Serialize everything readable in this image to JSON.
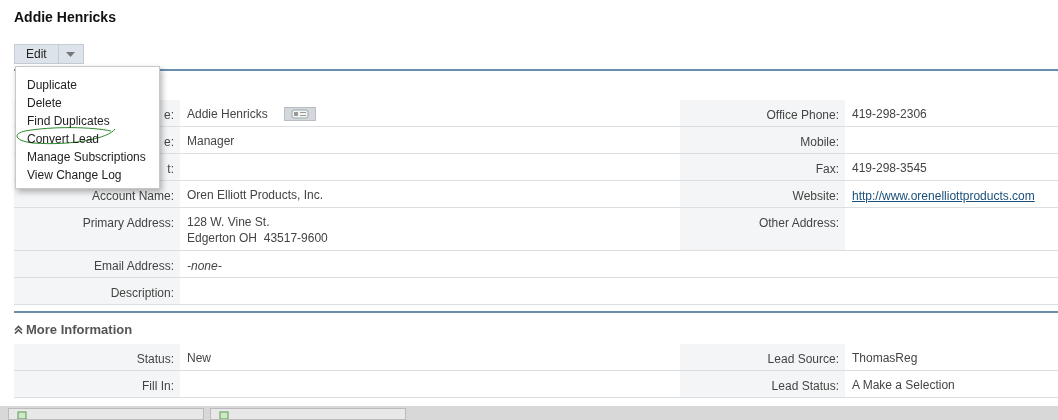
{
  "title": "Addie Henricks",
  "edit_button": {
    "label": "Edit"
  },
  "menu": {
    "items": [
      {
        "label": "Duplicate",
        "circled": false
      },
      {
        "label": "Delete",
        "circled": false
      },
      {
        "label": "Find Duplicates",
        "circled": false
      },
      {
        "label": "Convert Lead",
        "circled": true
      },
      {
        "label": "Manage Subscriptions",
        "circled": false
      },
      {
        "label": "View Change Log",
        "circled": false
      }
    ]
  },
  "overview": {
    "rows": [
      {
        "left": {
          "label": "e:",
          "kind": "card",
          "lines": [
            "Addie Henricks"
          ]
        },
        "right": {
          "label": "Office Phone:",
          "kind": "text",
          "lines": [
            "419-298-2306"
          ]
        }
      },
      {
        "left": {
          "label": "e:",
          "kind": "text",
          "lines": [
            "Manager"
          ]
        },
        "right": {
          "label": "Mobile:"
        }
      },
      {
        "left": {
          "label": "t:"
        },
        "right": {
          "label": "Fax:",
          "kind": "text",
          "lines": [
            "419-298-3545"
          ]
        }
      },
      {
        "left": {
          "label": "Account Name:",
          "kind": "text",
          "lines": [
            "Oren Elliott Products, Inc."
          ]
        },
        "right": {
          "label": "Website:",
          "kind": "link",
          "lines": [
            "http://www.orenelliottproducts.com"
          ]
        }
      },
      {
        "left": {
          "label": "Primary Address:",
          "kind": "text",
          "lines": [
            "128 W. Vine St.",
            "Edgerton OH  43517-9600"
          ]
        },
        "right": {
          "label": "Other Address:"
        }
      },
      {
        "left": {
          "label": "Email Address:",
          "kind": "empty",
          "lines": [
            "-none-"
          ]
        },
        "right": null
      },
      {
        "left": {
          "label": "Description:"
        },
        "right": null
      }
    ]
  },
  "more_information": {
    "title": "More Information",
    "expanded": true,
    "rows": [
      {
        "left": {
          "label": "Status:",
          "kind": "text",
          "lines": [
            "New"
          ]
        },
        "right": {
          "label": "Lead Source:",
          "kind": "text",
          "lines": [
            "ThomasReg"
          ]
        }
      },
      {
        "left": {
          "label": "Fill In:"
        },
        "right": {
          "label": "Lead Status:",
          "kind": "text",
          "lines": [
            "A Make a Selection"
          ]
        }
      }
    ]
  }
}
